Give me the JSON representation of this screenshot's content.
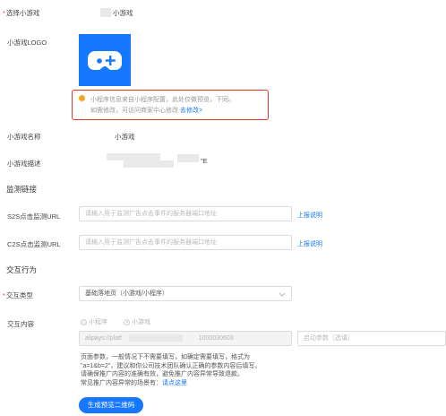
{
  "form": {
    "select_game_label": "选择小游戏",
    "select_game_value": "小游戏",
    "logo_label": "小游戏LOGO",
    "notice_text_1": "小程序信息来自小程序配置，此处仅做预览，下同。",
    "notice_text_2": "如需修改，可访问商家中心修改",
    "notice_link": "去修改>",
    "name_label": "小游戏名称",
    "name_value": "小游戏",
    "desc_label": "小游戏描述",
    "desc_value_tail": "\"E"
  },
  "monitor": {
    "section_title": "监测链接",
    "s2s_label": "S2S点击监测URL",
    "s2s_placeholder": "请输入用于监测广告点击事件的服务器端口地址",
    "s2s_link": "上报说明",
    "c2s_label": "C2S点击监测URL",
    "c2s_placeholder": "请输入用于监测广告点击事件的服务器端口地址",
    "c2s_link": "上报说明"
  },
  "interaction": {
    "section_title": "交互行为",
    "type_label": "交互类型",
    "type_value": "基础落地页（小游戏/小程序）",
    "content_label": "交互内容",
    "radio_miniprogram": "小程序",
    "radio_minigame": "小游戏",
    "path_value": "alipays://platf",
    "path_value_tail": "1000030603",
    "param_placeholder": "启动参数（选填）",
    "help_line1": "页面参数，一般情况下不需要填写，如确定需要填写，格式为",
    "help_line2": "\"a=1&b=2\"，建议和你公司技术团队确认正确的参数内容后填写。",
    "help_line3": "请确保推广内容的准确有效，避免推广内容异常导致退款。",
    "help_line4": "常见推广内容异常的场景有：",
    "help_link": "请点这里",
    "qr_button": "生成预览二维码"
  },
  "colors": {
    "logo_bg": "#1677ff",
    "accent": "#1677ff",
    "notice_border": "#e2362b",
    "notice_dot": "#f5a623"
  }
}
